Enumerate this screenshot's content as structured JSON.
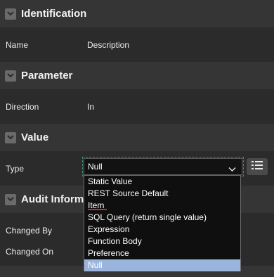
{
  "sections": {
    "identification": {
      "title": "Identification"
    },
    "parameter": {
      "title": "Parameter"
    },
    "value": {
      "title": "Value"
    },
    "audit": {
      "title": "Audit Informa"
    }
  },
  "fields": {
    "name": {
      "label": "Name",
      "value": "Description"
    },
    "direction": {
      "label": "Direction",
      "value": "In"
    },
    "type": {
      "label": "Type",
      "value": "Null"
    },
    "changed_by": {
      "label": "Changed By"
    },
    "changed_on": {
      "label": "Changed On"
    }
  },
  "type_options": [
    "Static Value",
    "REST Source Default",
    "Item",
    "SQL Query (return single value)",
    "Expression",
    "Function Body",
    "Preference",
    "Null"
  ],
  "selected_option": "Null",
  "colors": {
    "page_bg": "#2b2b2b",
    "header_bg": "#353535",
    "select_bg": "#121212",
    "selected_option_bg": "#9ab5dd",
    "annotation_underline": "#e02424"
  },
  "icons": {
    "section_toggle": "chevron-down-icon",
    "select_arrow": "chevron-down-icon",
    "lov_button": "list-icon"
  }
}
